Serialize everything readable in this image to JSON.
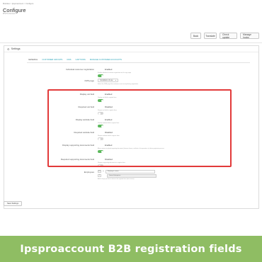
{
  "header": {
    "breadcrumb": "Modules > Ipsproaccount > Configure",
    "title": "Configure",
    "subtitle": "IPS Pro Account"
  },
  "toolbar": {
    "back": "Back",
    "translate": "Translate",
    "check_update": "Check update",
    "manage_hooks": "Manage hooks"
  },
  "panel": {
    "title": "Settings",
    "tabs": [
      "GENERAL",
      "CUSTOMER GROUPS",
      "CMS",
      "CAPTIONS",
      "MANAGE CUSTOMER ACCOUNTS"
    ]
  },
  "rows": {
    "individual": {
      "label": "Individual customer registration",
      "state": "Enabled",
      "help": "Enable individual customer registration on the sign page"
    },
    "cms": {
      "label": "CMS page",
      "value": "Conditions of use",
      "help": "Select the CMS page that customers must accept during registration"
    },
    "display_vat": {
      "label": "Display vat field",
      "state": "Enabled",
      "help": "Display vat field in register form"
    },
    "required_vat": {
      "label": "Required vat field",
      "state": "Disabled",
      "help": "Require vat field in register form"
    },
    "display_website": {
      "label": "Display website field",
      "state": "Enabled",
      "help": "Display website field in register form"
    },
    "required_website": {
      "label": "Required website field",
      "state": "Disabled",
      "help": "Require website field in register form"
    },
    "display_docs": {
      "label": "Display supporting documents field",
      "state": "Enabled",
      "help": "Allow customer to upload supporting documents (business license, certificate of incorporation, etc) during registration process"
    },
    "required_docs": {
      "label": "Required supporting documents field",
      "state": "Disabled",
      "help": "Require supporting documents in register form"
    },
    "employees": {
      "label": "Employees",
      "row1_num": "10",
      "row1_unit": "to",
      "row1_value": "Employee name",
      "row2_num": "1",
      "row2_value": "Some Enterprise",
      "help": "Add a range per line to show in the register form (min to max)"
    }
  },
  "footer": {
    "save": "Save Settings"
  },
  "banner": {
    "text": "Ipsproaccount B2B registration fields"
  },
  "colors": {
    "highlight": "#e23a3a",
    "toggle_on": "#5cb85c",
    "banner": "#8fbd63",
    "tab": "#2aa3b8"
  }
}
